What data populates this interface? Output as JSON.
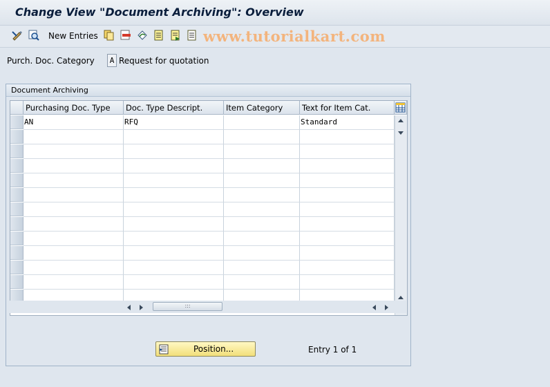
{
  "window": {
    "title": "Change View \"Document Archiving\": Overview"
  },
  "toolbar": {
    "icons": [
      "display-change-icon",
      "details-icon",
      "copy-as-icon",
      "delete-icon",
      "undo-change-icon",
      "select-all-icon",
      "select-block-icon",
      "deselect-all-icon"
    ],
    "new_entries_label": "New Entries"
  },
  "watermark": "www.tutorialkart.com",
  "header_field": {
    "label": "Purch. Doc. Category",
    "key": "A",
    "value": "Request for quotation"
  },
  "panel": {
    "title": "Document Archiving"
  },
  "table": {
    "columns": [
      "Purchasing Doc. Type",
      "Doc. Type Descript.",
      "Item Category",
      "Text for Item Cat."
    ],
    "rows": [
      [
        "AN",
        "RFQ",
        "",
        "Standard"
      ]
    ]
  },
  "footer": {
    "position_button_label": "Position...",
    "entry_count": "Entry 1 of 1"
  },
  "colors": {
    "background": "#dfe6ee",
    "title_text": "#0a1e3c",
    "watermark": "#f3b47d",
    "button_yellow": "#f2df7a"
  }
}
